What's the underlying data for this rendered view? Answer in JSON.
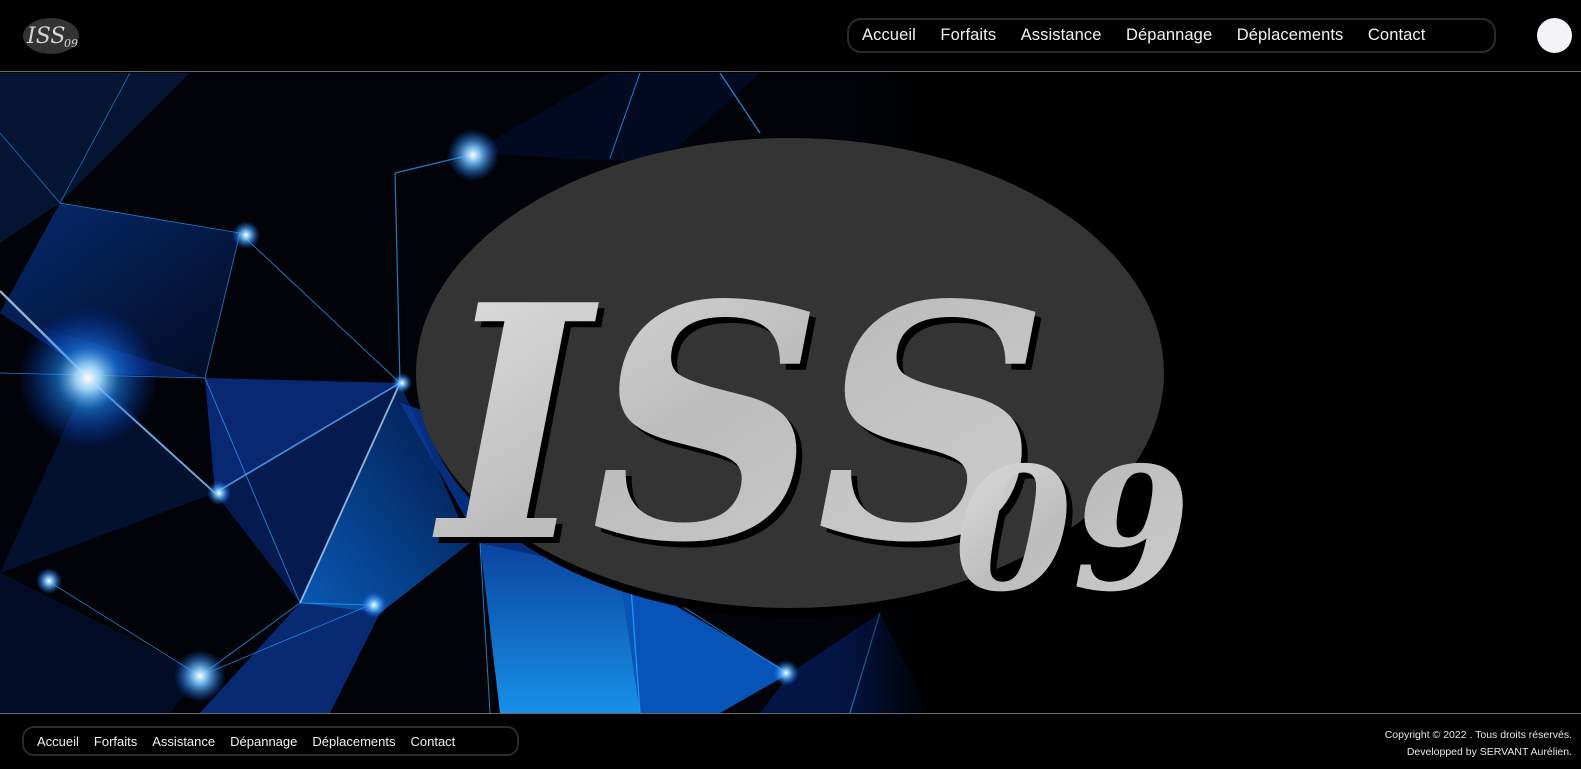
{
  "brand": {
    "logo_main": "ISS",
    "logo_sub": "09"
  },
  "nav": {
    "items": [
      {
        "label": "Accueil"
      },
      {
        "label": "Forfaits"
      },
      {
        "label": "Assistance"
      },
      {
        "label": "Dépannage"
      },
      {
        "label": "Déplacements"
      },
      {
        "label": "Contact"
      }
    ]
  },
  "hero": {
    "logo_main": "ISS",
    "logo_sub": "09"
  },
  "footer": {
    "nav": [
      {
        "label": "Accueil"
      },
      {
        "label": "Forfaits"
      },
      {
        "label": "Assistance"
      },
      {
        "label": "Dépannage"
      },
      {
        "label": "Déplacements"
      },
      {
        "label": "Contact"
      }
    ],
    "copyright_line1": "Copyright © 2022 . Tous droits réservés.",
    "copyright_line2": "Developped by SERVANT Aurélien."
  },
  "colors": {
    "background": "#000000",
    "logo_oval": "#333333",
    "logo_text": "#c9c9c9",
    "network_blue": "#1e8fff"
  },
  "icons": {
    "profile": "profile-circle-icon"
  }
}
